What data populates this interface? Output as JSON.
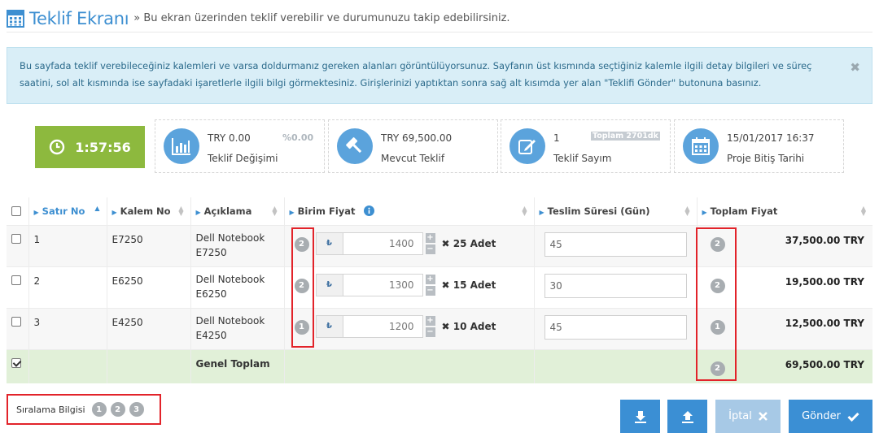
{
  "header": {
    "title": "Teklif Ekranı",
    "subtitle": "» Bu ekran üzerinden teklif verebilir ve durumunuzu takip edebilirsiniz."
  },
  "alert": {
    "text": "Bu sayfada teklif verebileceğiniz kalemleri ve varsa doldurmanız gereken alanları görüntülüyorsunuz. Sayfanın üst kısmında seçtiğiniz kalemle ilgili detay bilgileri ve süreç saatini, sol alt kısmında ise sayfadaki işaretlerle ilgili bilgi görmektesiniz. Girişlerinizi yaptıktan sonra sağ alt kısımda yer alan \"Teklifi Gönder\" butonuna basınız.",
    "close": "✖"
  },
  "timer": {
    "value": "1:57:56"
  },
  "stats": {
    "change": {
      "value": "TRY 0.00",
      "extra": "%0.00",
      "label": "Teklif Değişimi",
      "icon": "bar-chart-icon"
    },
    "current": {
      "value": "TRY 69,500.00",
      "label": "Mevcut Teklif",
      "icon": "gavel-icon"
    },
    "count": {
      "value": "1",
      "extra": "Toplam 2701dk",
      "label": "Teklif Sayım",
      "icon": "edit-icon"
    },
    "deadline": {
      "value": "15/01/2017 16:37",
      "label": "Proje Bitiş Tarihi",
      "icon": "calendar-icon"
    }
  },
  "table": {
    "columns": {
      "row_no": "Satır No",
      "item_no": "Kalem No",
      "description": "Açıklama",
      "unit_price": "Birim Fiyat",
      "delivery": "Teslim Süresi (Gün)",
      "total": "Toplam Fiyat"
    },
    "currency_symbol": "₺",
    "rows": [
      {
        "row_no": "1",
        "item_no": "E7250",
        "description": "Dell Notebook E7250",
        "price_rank": "2",
        "price": "1400",
        "qty": "✖ 25 Adet",
        "delivery": "45",
        "total_rank": "2",
        "total": "37,500.00 TRY"
      },
      {
        "row_no": "2",
        "item_no": "E6250",
        "description": "Dell Notebook E6250",
        "price_rank": "2",
        "price": "1300",
        "qty": "✖ 15 Adet",
        "delivery": "30",
        "total_rank": "2",
        "total": "19,500.00 TRY"
      },
      {
        "row_no": "3",
        "item_no": "E4250",
        "description": "Dell Notebook E4250",
        "price_rank": "1",
        "price": "1200",
        "qty": "✖ 10 Adet",
        "delivery": "45",
        "total_rank": "1",
        "total": "12,500.00 TRY"
      }
    ],
    "grand_total": {
      "label": "Genel Toplam",
      "rank": "2",
      "total": "69,500.00 TRY"
    }
  },
  "sort_info": {
    "label": "Sıralama Bilgisi",
    "ranks": [
      "1",
      "2",
      "3"
    ]
  },
  "buttons": {
    "download_icon": "download-icon",
    "upload_icon": "upload-icon",
    "cancel": "İptal",
    "send": "Gönder"
  },
  "colors": {
    "primary": "#3b8fd4",
    "timer": "#8db93e",
    "alert_bg": "#d9eef7",
    "highlight": "#e2232a",
    "total_row": "#e1f0d8"
  }
}
